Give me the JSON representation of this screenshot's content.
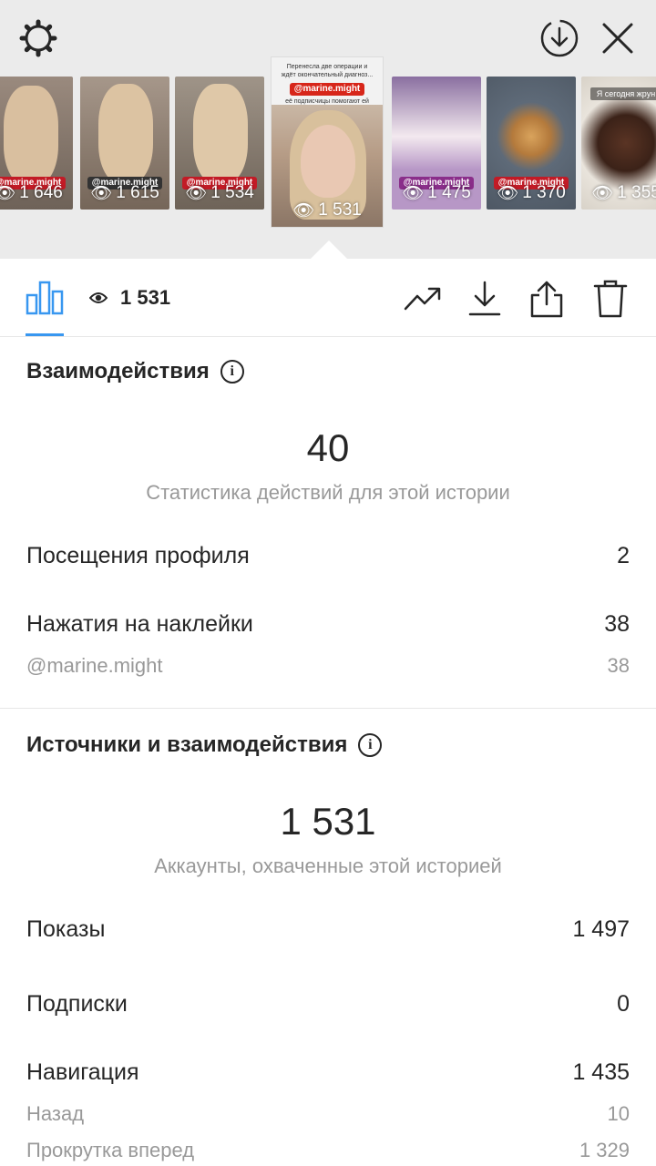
{
  "story_strip": {
    "thumbs": [
      {
        "views": "1 646",
        "tag": "@marine.might",
        "tag_color": "#c21b26"
      },
      {
        "views": "1 615",
        "tag": "@marine.might",
        "tag_color": "#333333"
      },
      {
        "views": "1 534",
        "tag": "@marine.might",
        "tag_color": "#c21b26"
      },
      {
        "views": "1 475",
        "tag": "@marine.might",
        "tag_color": "#8a2e8a"
      },
      {
        "views": "1 370",
        "tag": "@marine.might",
        "tag_color": "#c21b26"
      },
      {
        "views": "1 355",
        "tag": "Я сегодня жрун",
        "tag_color": "#222222"
      }
    ],
    "selected": {
      "caption_top": "Перенесла две операции и ждёт окончательный диагноз...",
      "handle": "@marine.might",
      "caption_bottom": "её подписчицы помогают ей оставаться сильной, но смотри на её что...",
      "views": "1 531"
    }
  },
  "toolbar": {
    "views": "1 531"
  },
  "interactions": {
    "title": "Взаимодействия",
    "total": "40",
    "subtitle": "Статистика действий для этой истории",
    "rows": [
      {
        "label": "Посещения профиля",
        "value": "2"
      },
      {
        "label": "Нажатия на наклейки",
        "value": "38"
      },
      {
        "label": "@marine.might",
        "value": "38"
      }
    ]
  },
  "sources": {
    "title": "Источники и взаимодействия",
    "total": "1 531",
    "subtitle": "Аккаунты, охваченные этой историей",
    "rows": [
      {
        "label": "Показы",
        "value": "1 497"
      },
      {
        "label": "Подписки",
        "value": "0"
      },
      {
        "label": "Навигация",
        "value": "1 435"
      },
      {
        "label": "Назад",
        "value": "10"
      },
      {
        "label": "Прокрутка вперед",
        "value": "1 329"
      }
    ]
  },
  "colors": {
    "accent": "#3897f0",
    "muted": "#999999",
    "text": "#262626"
  }
}
